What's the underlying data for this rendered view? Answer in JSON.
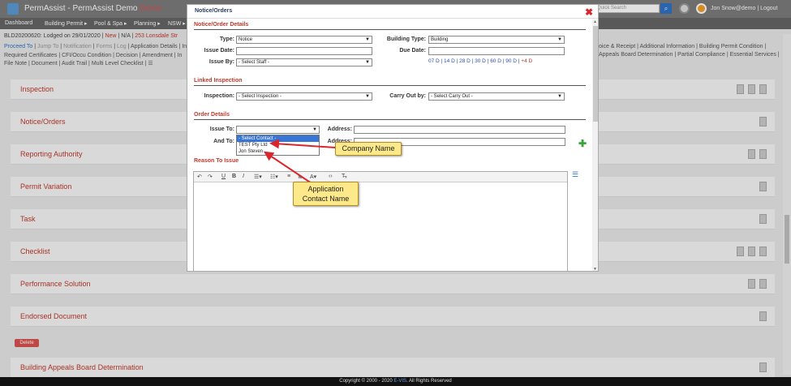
{
  "app": {
    "title": "PermAssist - PermAssist Demo",
    "demo_label": "Demo"
  },
  "search": {
    "placeholder": "Quick Search"
  },
  "user": {
    "name": "Jon Snow@demo",
    "separator": "|",
    "logout": "Logout"
  },
  "nav": [
    "Dashboard",
    "Building Permit ▸",
    "Pool & Spa ▸",
    "Planning ▸",
    "NSW ▸"
  ],
  "record": {
    "id": "BLD20200620:",
    "lodged": "Lodged on 29/01/2020",
    "status_new": "New",
    "na": "N/A",
    "address": "253 Lonsdale Str"
  },
  "links_row1": [
    "Proceed To",
    "Jump To",
    "Notification",
    "Forms",
    "Log",
    "Application Details",
    "In"
  ],
  "links_row2": [
    "Required Certificates",
    "CFI/Occu Condition",
    "Decision",
    "Amendment",
    "In"
  ],
  "links_row3": [
    "File Note",
    "Document",
    "Audit Trail",
    "Multi Level Checklist"
  ],
  "links_right1": [
    "oice & Receipt",
    "Additional Information",
    "Building Permit Condition"
  ],
  "links_right2": [
    "Appeals Board Determination",
    "Partial Compliance",
    "Essential Services"
  ],
  "sections": [
    "Inspection",
    "Notice/Orders",
    "Reporting Authority",
    "Permit Variation",
    "Task",
    "Checklist",
    "Performance Solution",
    "Endorsed Document",
    "Building Appeals Board Determination"
  ],
  "delete_label": "Delete",
  "footer": {
    "text": "Copyright © 2000 - 2020",
    "brand": "E-VIS",
    "rights": ". All Rights Reserved"
  },
  "modal": {
    "title": "Notice/Orders",
    "details_heading": "Notice/Order Details",
    "type_label": "Type:",
    "type_value": "Notice",
    "building_type_label": "Building Type:",
    "building_type_value": "Building",
    "issue_date_label": "Issue Date:",
    "due_date_label": "Due Date:",
    "issue_by_label": "Issue By:",
    "issue_by_value": "- Select Staff -",
    "days": [
      "07 D",
      "14 D",
      "28 D",
      "30 D",
      "60 D",
      "90 D"
    ],
    "days_extra": "+4 D",
    "linked_heading": "Linked Inspection",
    "inspection_label": "Inspection:",
    "inspection_value": "- Select Inspection -",
    "carry_out_label": "Carry Out by:",
    "carry_out_value": "- Select Carry Out -",
    "order_heading": "Order Details",
    "issue_to_label": "Issue To:",
    "and_to_label": "And To:",
    "address_label": "Address:",
    "dropdown_options": [
      "- Select Contact -",
      "TEST Pty Ltd",
      "Jon Steven"
    ],
    "reason_heading": "Reason To Issue"
  },
  "callouts": {
    "company": "Company Name",
    "contact_line1": "Application",
    "contact_line2": "Contact Name"
  }
}
